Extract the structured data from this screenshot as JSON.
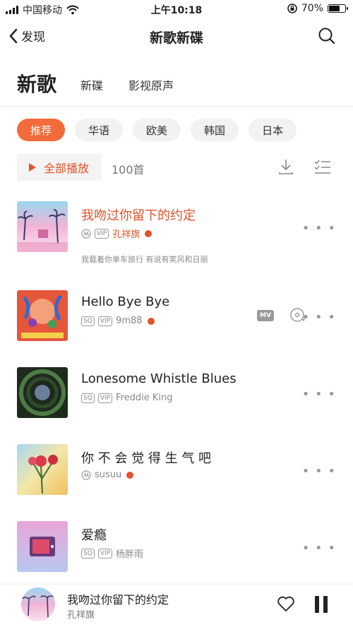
{
  "status": {
    "carrier": "中国移动",
    "time": "上午10:18",
    "battery": "70%",
    "battery_level": 0.7
  },
  "nav": {
    "back_label": "发现",
    "title": "新歌新碟"
  },
  "tabs": {
    "active": "新歌",
    "items": [
      "新碟",
      "影视原声"
    ]
  },
  "chips": [
    "推荐",
    "华语",
    "欧美",
    "韩国",
    "日本"
  ],
  "playbar": {
    "play_all": "全部播放",
    "count": "100首"
  },
  "songs": [
    {
      "title": "我吻过你留下的约定",
      "artist": "孔祥旗",
      "badges": [
        "VIP"
      ],
      "subtitle": "我载着你单车旅行 有说有笑风和日丽",
      "highlight": true
    },
    {
      "title": "Hello Bye Bye",
      "artist": "9m88",
      "badges": [
        "SQ",
        "VIP"
      ],
      "mv": "MV"
    },
    {
      "title": "Lonesome Whistle Blues",
      "artist": "Freddie King",
      "badges": [
        "SQ",
        "VIP"
      ]
    },
    {
      "title": "你 不 会 觉 得 生 气 吧",
      "artist": "susuu",
      "badges": []
    },
    {
      "title": "爱瘾",
      "artist": "杨胖雨",
      "badges": [
        "SQ",
        "VIP"
      ]
    }
  ],
  "mini_player": {
    "title": "我吻过你留下的约定",
    "artist": "孔祥旗"
  },
  "colors": {
    "accent": "#e2532a",
    "chip_active": "#f26b3a"
  },
  "icons": [
    "signal-icon",
    "wifi-icon",
    "lock-rotation-icon",
    "battery-icon",
    "back-chevron-icon",
    "search-icon",
    "play-icon",
    "download-icon",
    "multi-select-icon",
    "audio-quality-icon",
    "more-icon",
    "mv-icon",
    "disc-icon",
    "heart-icon",
    "pause-icon"
  ]
}
